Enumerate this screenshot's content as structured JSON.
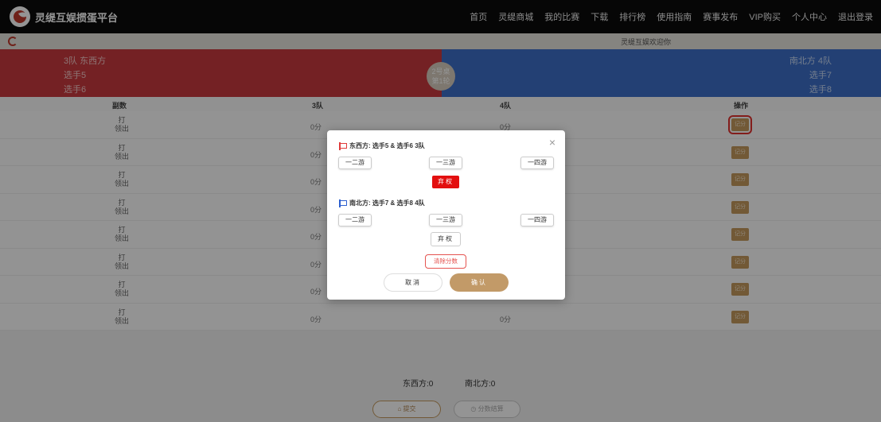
{
  "brand": {
    "name": "灵缇互娱掼蛋平台"
  },
  "nav": [
    "首页",
    "灵缇商城",
    "我的比赛",
    "下载",
    "排行榜",
    "使用指南",
    "赛事发布",
    "VIP购买",
    "个人中心",
    "退出登录"
  ],
  "subbar": {
    "welcome": "灵缇互娱欢迎你"
  },
  "banner": {
    "left_team": "3队 东西方",
    "left_p1": "选手5",
    "left_p2": "选手6",
    "right_team": "南北方 4队",
    "right_p1": "选手7",
    "right_p2": "选手8",
    "table_line1": "2号桌",
    "table_line2": "第1轮"
  },
  "table": {
    "headers": [
      "副数",
      "3队",
      "4队",
      "操作"
    ],
    "rows": [
      {
        "play": "打",
        "lead": "领出",
        "a": "0分",
        "b": "0分",
        "action": "记分"
      },
      {
        "play": "打",
        "lead": "领出",
        "a": "0分",
        "b": "",
        "action": "记分"
      },
      {
        "play": "打",
        "lead": "领出",
        "a": "0分",
        "b": "",
        "action": "记分"
      },
      {
        "play": "打",
        "lead": "领出",
        "a": "0分",
        "b": "",
        "action": "记分"
      },
      {
        "play": "打",
        "lead": "领出",
        "a": "0分",
        "b": "",
        "action": "记分"
      },
      {
        "play": "打",
        "lead": "领出",
        "a": "0分",
        "b": "",
        "action": "记分"
      },
      {
        "play": "打",
        "lead": "领出",
        "a": "0分",
        "b": "",
        "action": "记分"
      },
      {
        "play": "打",
        "lead": "领出",
        "a": "0分",
        "b": "0分",
        "action": "记分"
      }
    ]
  },
  "totals": {
    "east_west": "东西方:0",
    "north_south": "南北方:0",
    "submit": "⌂ 提交",
    "settle": "◷ 分数结算"
  },
  "modal": {
    "close": "×",
    "ew_title": "东西方: 选手5 & 选手6 3队",
    "ns_title": "南北方: 选手7 & 选手8 4队",
    "opt1": "一二游",
    "opt2": "一三游",
    "opt3": "一四游",
    "forfeit": "弃权",
    "clear": "清除分数",
    "cancel": "取消",
    "confirm": "确认"
  }
}
